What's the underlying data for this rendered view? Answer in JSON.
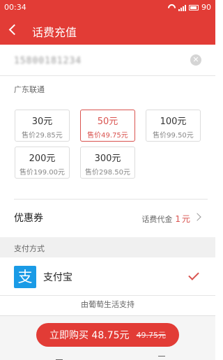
{
  "status_bar": {
    "time": "00:34",
    "battery": "90"
  },
  "header": {
    "title": "话费充值",
    "back_icon": "chevron-left-icon"
  },
  "phone": {
    "value": "15800181234",
    "clear_icon": "clear-circle-icon"
  },
  "carrier": "广东联通",
  "amounts": [
    {
      "face": "30元",
      "price": "售价29.85元",
      "selected": false
    },
    {
      "face": "50元",
      "price": "售价49.75元",
      "selected": true
    },
    {
      "face": "100元",
      "price": "售价99.50元",
      "selected": false
    },
    {
      "face": "200元",
      "price": "售价199.00元",
      "selected": false
    },
    {
      "face": "300元",
      "price": "售价298.50元",
      "selected": false
    }
  ],
  "coupon": {
    "label": "优惠券",
    "prefix": "话费代金",
    "amount": "1",
    "unit": "元"
  },
  "payment": {
    "section_label": "支付方式",
    "method": "支付宝",
    "icon": "alipay-icon",
    "icon_glyph": "支",
    "support": "由葡萄生活支持"
  },
  "footer": {
    "buy_label": "立即购买 48.75元",
    "original_price": "49.75元"
  },
  "colors": {
    "accent": "#e23c36",
    "selected": "#d9534f",
    "alipay": "#1a9be6"
  }
}
